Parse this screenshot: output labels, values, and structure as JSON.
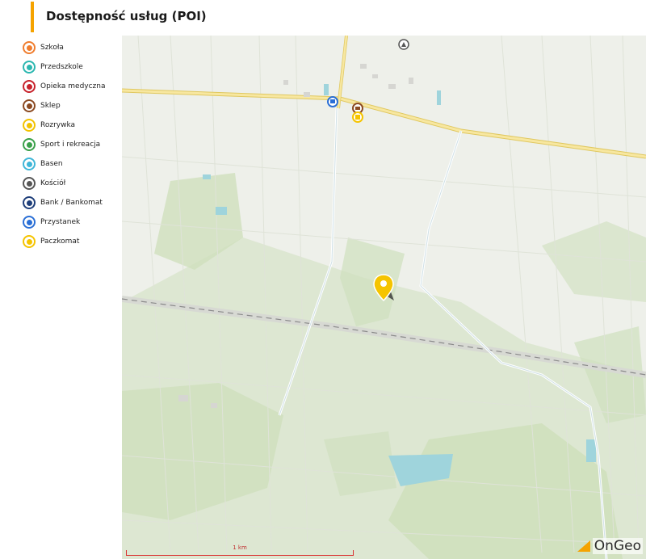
{
  "title": "Dostępność usług (POI)",
  "legend": [
    {
      "label": "Szkoła",
      "color": "#f07d2e",
      "icon": "school-icon"
    },
    {
      "label": "Przedszkole",
      "color": "#2bb7b0",
      "icon": "kindergarten-icon"
    },
    {
      "label": "Opieka medyczna",
      "color": "#c8232c",
      "icon": "medical-icon"
    },
    {
      "label": "Sklep",
      "color": "#8b4a22",
      "icon": "shop-icon"
    },
    {
      "label": "Rozrywka",
      "color": "#f2c200",
      "icon": "entertainment-icon"
    },
    {
      "label": "Sport i rekreacja",
      "color": "#3aa04a",
      "icon": "sport-icon"
    },
    {
      "label": "Basen",
      "color": "#3fb6d8",
      "icon": "pool-icon"
    },
    {
      "label": "Kościół",
      "color": "#555555",
      "icon": "church-icon"
    },
    {
      "label": "Bank / Bankomat",
      "color": "#1f3f7a",
      "icon": "bank-icon"
    },
    {
      "label": "Przystanek",
      "color": "#2a6fd6",
      "icon": "bus-stop-icon"
    },
    {
      "label": "Paczkomat",
      "color": "#f5c400",
      "icon": "parcel-locker-icon"
    }
  ],
  "map": {
    "scale_label": "1 km",
    "brand": "OnGeo",
    "colors": {
      "road": "#f7e7a0",
      "road_outline": "#e0c860",
      "path": "#ffffff",
      "water": "#9fd4dc",
      "forest": "#cfe0bd",
      "field": "#eef0ea",
      "marker": "#f5c400"
    }
  }
}
